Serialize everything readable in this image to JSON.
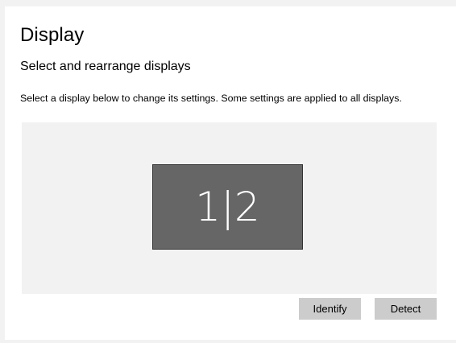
{
  "page": {
    "title": "Display",
    "subtitle": "Select and rearrange displays",
    "description": "Select a display below to change its settings. Some settings are applied to all displays."
  },
  "arrangement": {
    "monitor_label": "1|2",
    "colors": {
      "area_background": "#f2f2f2",
      "monitor_fill": "#666666",
      "monitor_border": "#333333",
      "monitor_text": "#ffffff"
    }
  },
  "actions": {
    "identify_label": "Identify",
    "detect_label": "Detect",
    "button_color": "#cccccc"
  }
}
